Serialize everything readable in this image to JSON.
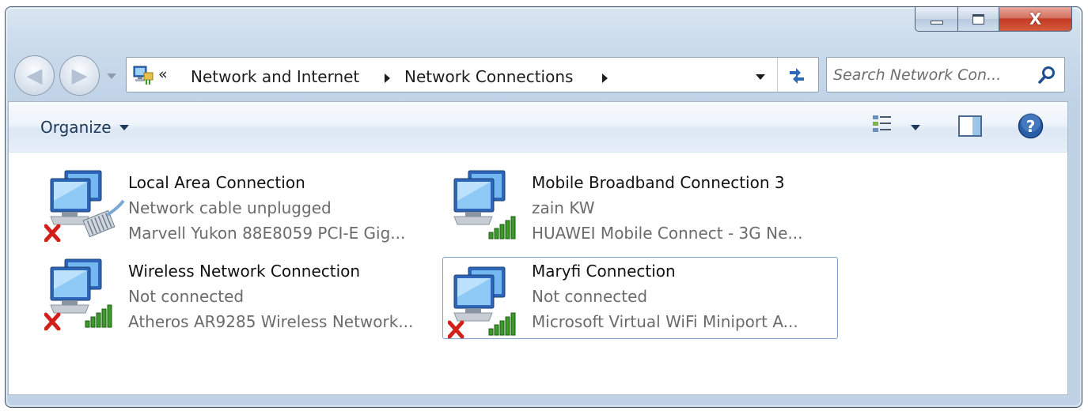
{
  "window": {
    "caption_buttons": {
      "minimize_icon": "minimize-icon",
      "maximize_icon": "maximize-icon",
      "close_glyph": "X"
    }
  },
  "navigation": {
    "back_icon": "back-arrow-icon",
    "forward_icon": "forward-arrow-icon",
    "overflow_chevron": "«",
    "breadcrumbs": [
      "Network and Internet",
      "Network Connections"
    ],
    "refresh_icon": "refresh-icon"
  },
  "search": {
    "placeholder": "Search Network Con..."
  },
  "command_bar": {
    "organize_label": "Organize",
    "view_icon": "change-view-icon",
    "preview_pane_icon": "preview-pane-icon",
    "help_icon": "help-icon"
  },
  "connections": [
    {
      "name": "Local Area Connection",
      "status": "Network cable unplugged",
      "device": "Marvell Yukon 88E8059 PCI-E Gig...",
      "type": "ethernet",
      "disabled": true,
      "selected": false
    },
    {
      "name": "Mobile Broadband Connection 3",
      "status": "zain KW",
      "device": "HUAWEI Mobile Connect - 3G Ne...",
      "type": "signal",
      "disabled": false,
      "selected": false
    },
    {
      "name": "Wireless Network Connection",
      "status": "Not connected",
      "device": "Atheros AR9285 Wireless Network...",
      "type": "signal",
      "disabled": true,
      "selected": false
    },
    {
      "name": "Maryfi Connection",
      "status": "Not connected",
      "device": "Microsoft Virtual WiFi Miniport A...",
      "type": "signal",
      "disabled": true,
      "selected": true
    }
  ],
  "colors": {
    "title_text": "#111111",
    "detail_text": "#6b6b6b",
    "selection_border": "#7da2ce",
    "error_red": "#d2201a",
    "signal_green": "#3b9a2a"
  }
}
